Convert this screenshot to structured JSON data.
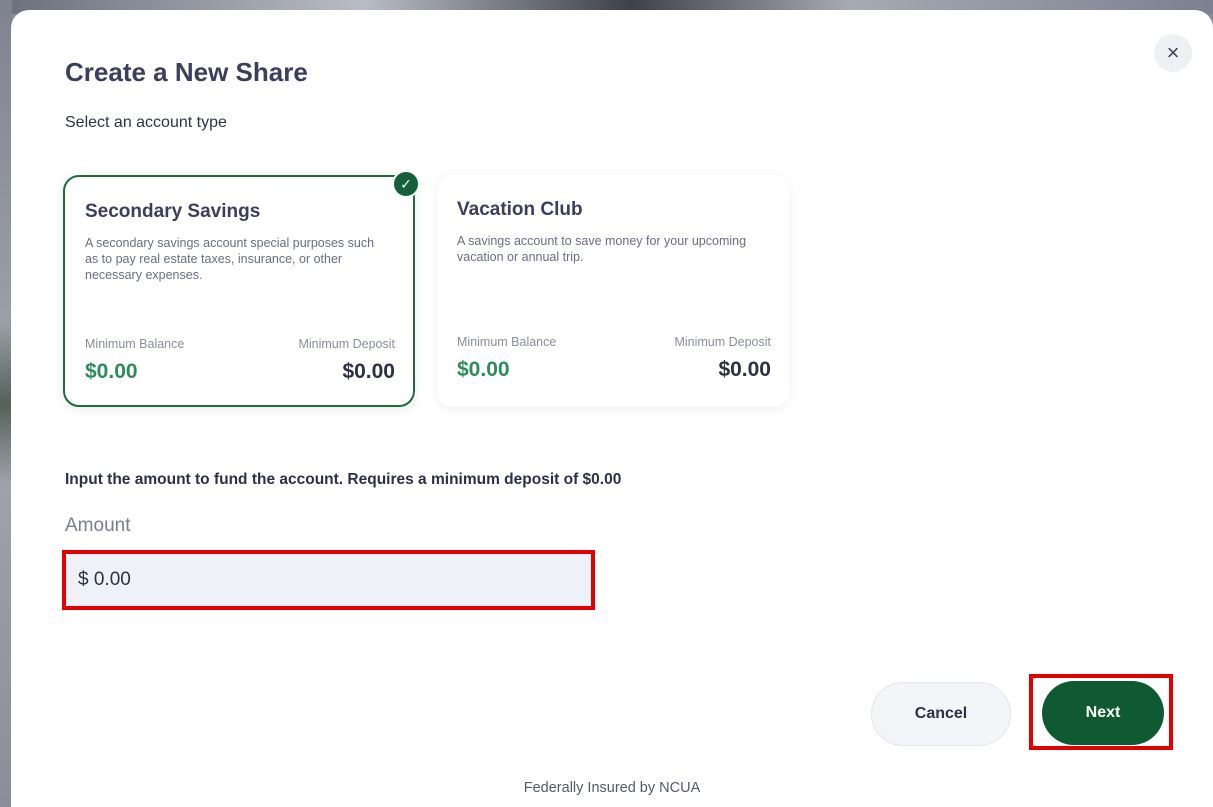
{
  "modal": {
    "title": "Create a New Share",
    "subtitle": "Select an account type",
    "close_icon": "×"
  },
  "accounts": [
    {
      "name": "Secondary Savings",
      "description": "A secondary savings account special purposes such as to pay real estate taxes, insurance, or other necessary expenses.",
      "min_balance_label": "Minimum Balance",
      "min_balance": "$0.00",
      "min_deposit_label": "Minimum Deposit",
      "min_deposit": "$0.00",
      "selected": true
    },
    {
      "name": "Vacation Club",
      "description": "A savings account to save money for your upcoming vacation or annual trip.",
      "min_balance_label": "Minimum Balance",
      "min_balance": "$0.00",
      "min_deposit_label": "Minimum Deposit",
      "min_deposit": "$0.00",
      "selected": false
    }
  ],
  "check_icon": "✓",
  "funding": {
    "instruction": "Input the amount to fund the account. Requires a minimum deposit of $0.00",
    "amount_label": "Amount",
    "amount_value": "$ 0.00"
  },
  "actions": {
    "cancel_label": "Cancel",
    "next_label": "Next"
  },
  "footer": {
    "text": "Federally Insured by NCUA"
  },
  "colors": {
    "primary": "#0f5a32",
    "accent_green": "#2e8c5c",
    "highlight": "#e30000"
  }
}
